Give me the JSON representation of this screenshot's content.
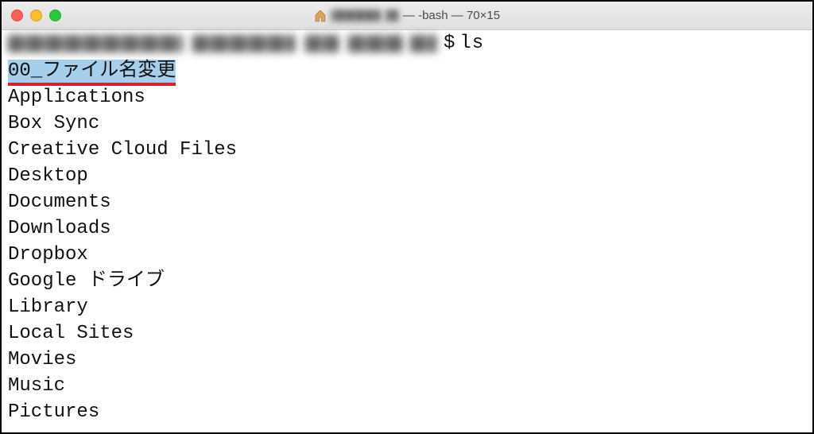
{
  "window": {
    "title_suffix": " — -bash — 70×15",
    "home_icon": "home-icon"
  },
  "prompt": {
    "sign": "$",
    "command": "ls"
  },
  "ls": {
    "highlighted": "00_ファイル名変更",
    "items": [
      "Applications",
      "Box Sync",
      "Creative Cloud Files",
      "Desktop",
      "Documents",
      "Downloads",
      "Dropbox",
      "Google ドライブ",
      "Library",
      "Local Sites",
      "Movies",
      "Music",
      "Pictures"
    ]
  }
}
